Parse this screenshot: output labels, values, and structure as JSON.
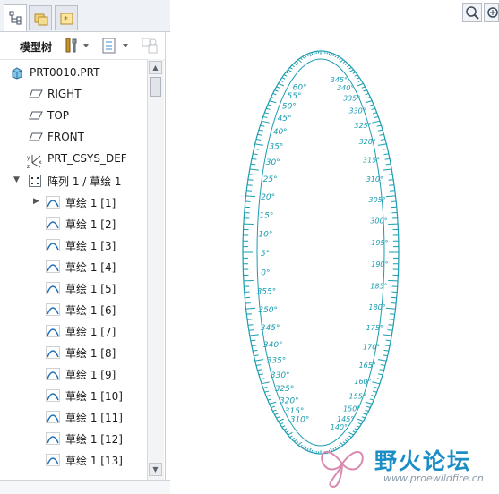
{
  "panel_tabs": [
    "model-tree",
    "folder-browser",
    "favorites"
  ],
  "toolbar": {
    "label": "模型树"
  },
  "tree": {
    "root": "PRT0010.PRT",
    "datums": [
      "RIGHT",
      "TOP",
      "FRONT"
    ],
    "csys": "PRT_CSYS_DEF",
    "pattern": "阵列 1 / 草绘 1",
    "sketches": [
      "草绘 1 [1]",
      "草绘 1 [2]",
      "草绘 1 [3]",
      "草绘 1 [4]",
      "草绘 1 [5]",
      "草绘 1 [6]",
      "草绘 1 [7]",
      "草绘 1 [8]",
      "草绘 1 [9]",
      "草绘 1 [10]",
      "草绘 1 [11]",
      "草绘 1 [12]",
      "草绘 1 [13]"
    ]
  },
  "ring": {
    "color": "#1a9cb0",
    "left_labels": [
      "310°",
      "315°",
      "320°",
      "325°",
      "330°",
      "335°",
      "340°",
      "345°",
      "350°",
      "355°",
      "0°",
      "5°",
      "10°",
      "15°",
      "20°",
      "25°",
      "30°",
      "35°",
      "40°",
      "45°",
      "50°",
      "55°",
      "60°"
    ],
    "right_labels": [
      "345°",
      "340°",
      "335°",
      "330°",
      "325°",
      "320°",
      "315°",
      "310°",
      "305°",
      "300°",
      "195°",
      "190°",
      "185°",
      "180°",
      "175°",
      "170°",
      "165°",
      "160°",
      "155°",
      "150°",
      "145°",
      "140°"
    ]
  },
  "watermark": {
    "text": "野火论坛",
    "url": "www.proewildfire.cn"
  }
}
